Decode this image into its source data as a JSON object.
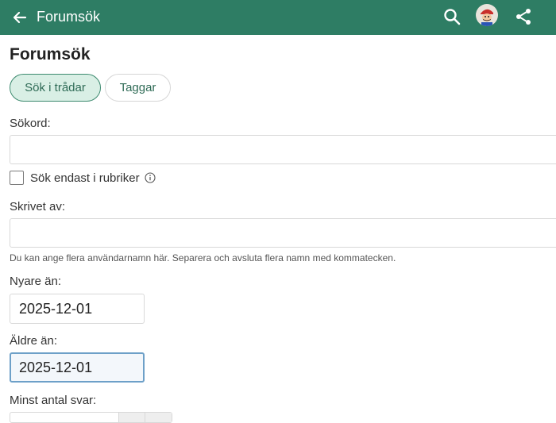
{
  "appbar": {
    "title": "Forumsök",
    "background_color": "#2e7d64",
    "icons": [
      "back-arrow-icon",
      "search-icon",
      "avatar",
      "share-icon"
    ]
  },
  "page": {
    "heading": "Forumsök"
  },
  "tabs": [
    {
      "label": "Sök i trådar",
      "active": true
    },
    {
      "label": "Taggar",
      "active": false
    }
  ],
  "form": {
    "keywords": {
      "label": "Sökord:",
      "value": ""
    },
    "titles_only": {
      "label": "Sök endast i rubriker",
      "checked": false
    },
    "posted_by": {
      "label": "Skrivet av:",
      "value": "",
      "hint": "Du kan ange flera användarnamn här. Separera och avsluta flera namn med kommatecken."
    },
    "newer_than": {
      "label": "Nyare än:",
      "value": "2025-12-01"
    },
    "older_than": {
      "label": "Äldre än:",
      "value": "2025-12-01"
    },
    "min_replies": {
      "label": "Minst antal svar:"
    }
  },
  "colors": {
    "accent": "#2e7d64",
    "tab_active_bg": "#d9efe5",
    "tab_text": "#2f6b56",
    "focus_border": "#6da0c8"
  }
}
